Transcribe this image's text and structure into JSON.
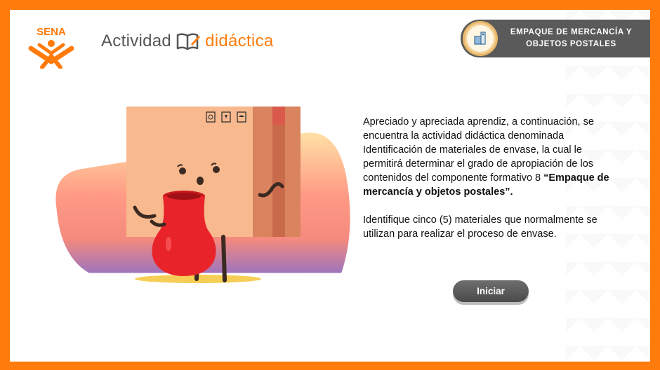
{
  "header": {
    "logo_text": "SENA",
    "activity_word": "Actividad",
    "activity_accent": "didáctica",
    "module_line1": "EMPAQUE DE MERCANCÍA Y",
    "module_line2": "OBJETOS POSTALES"
  },
  "main": {
    "intro_text": "Apreciado y apreciada aprendiz, a continuación, se encuentra la actividad didáctica denominada Identificación de materiales de envase, la cual le permitirá determinar el grado de apropiación de los contenidos del componente formativo 8 ",
    "intro_bold": "“Empaque de mercancía y objetos postales”.",
    "instruction_text": "Identifique cinco (5) materiales que normalmente se utilizan para realizar el proceso de envase.",
    "start_label": "Iniciar"
  },
  "colors": {
    "brand_orange": "#ff7b0b",
    "badge_gray": "#5a5a5a",
    "button_gray": "#555555"
  },
  "icons": [
    "sena-logo",
    "book-pencil-icon",
    "module-icon",
    "box-character-illustration"
  ]
}
